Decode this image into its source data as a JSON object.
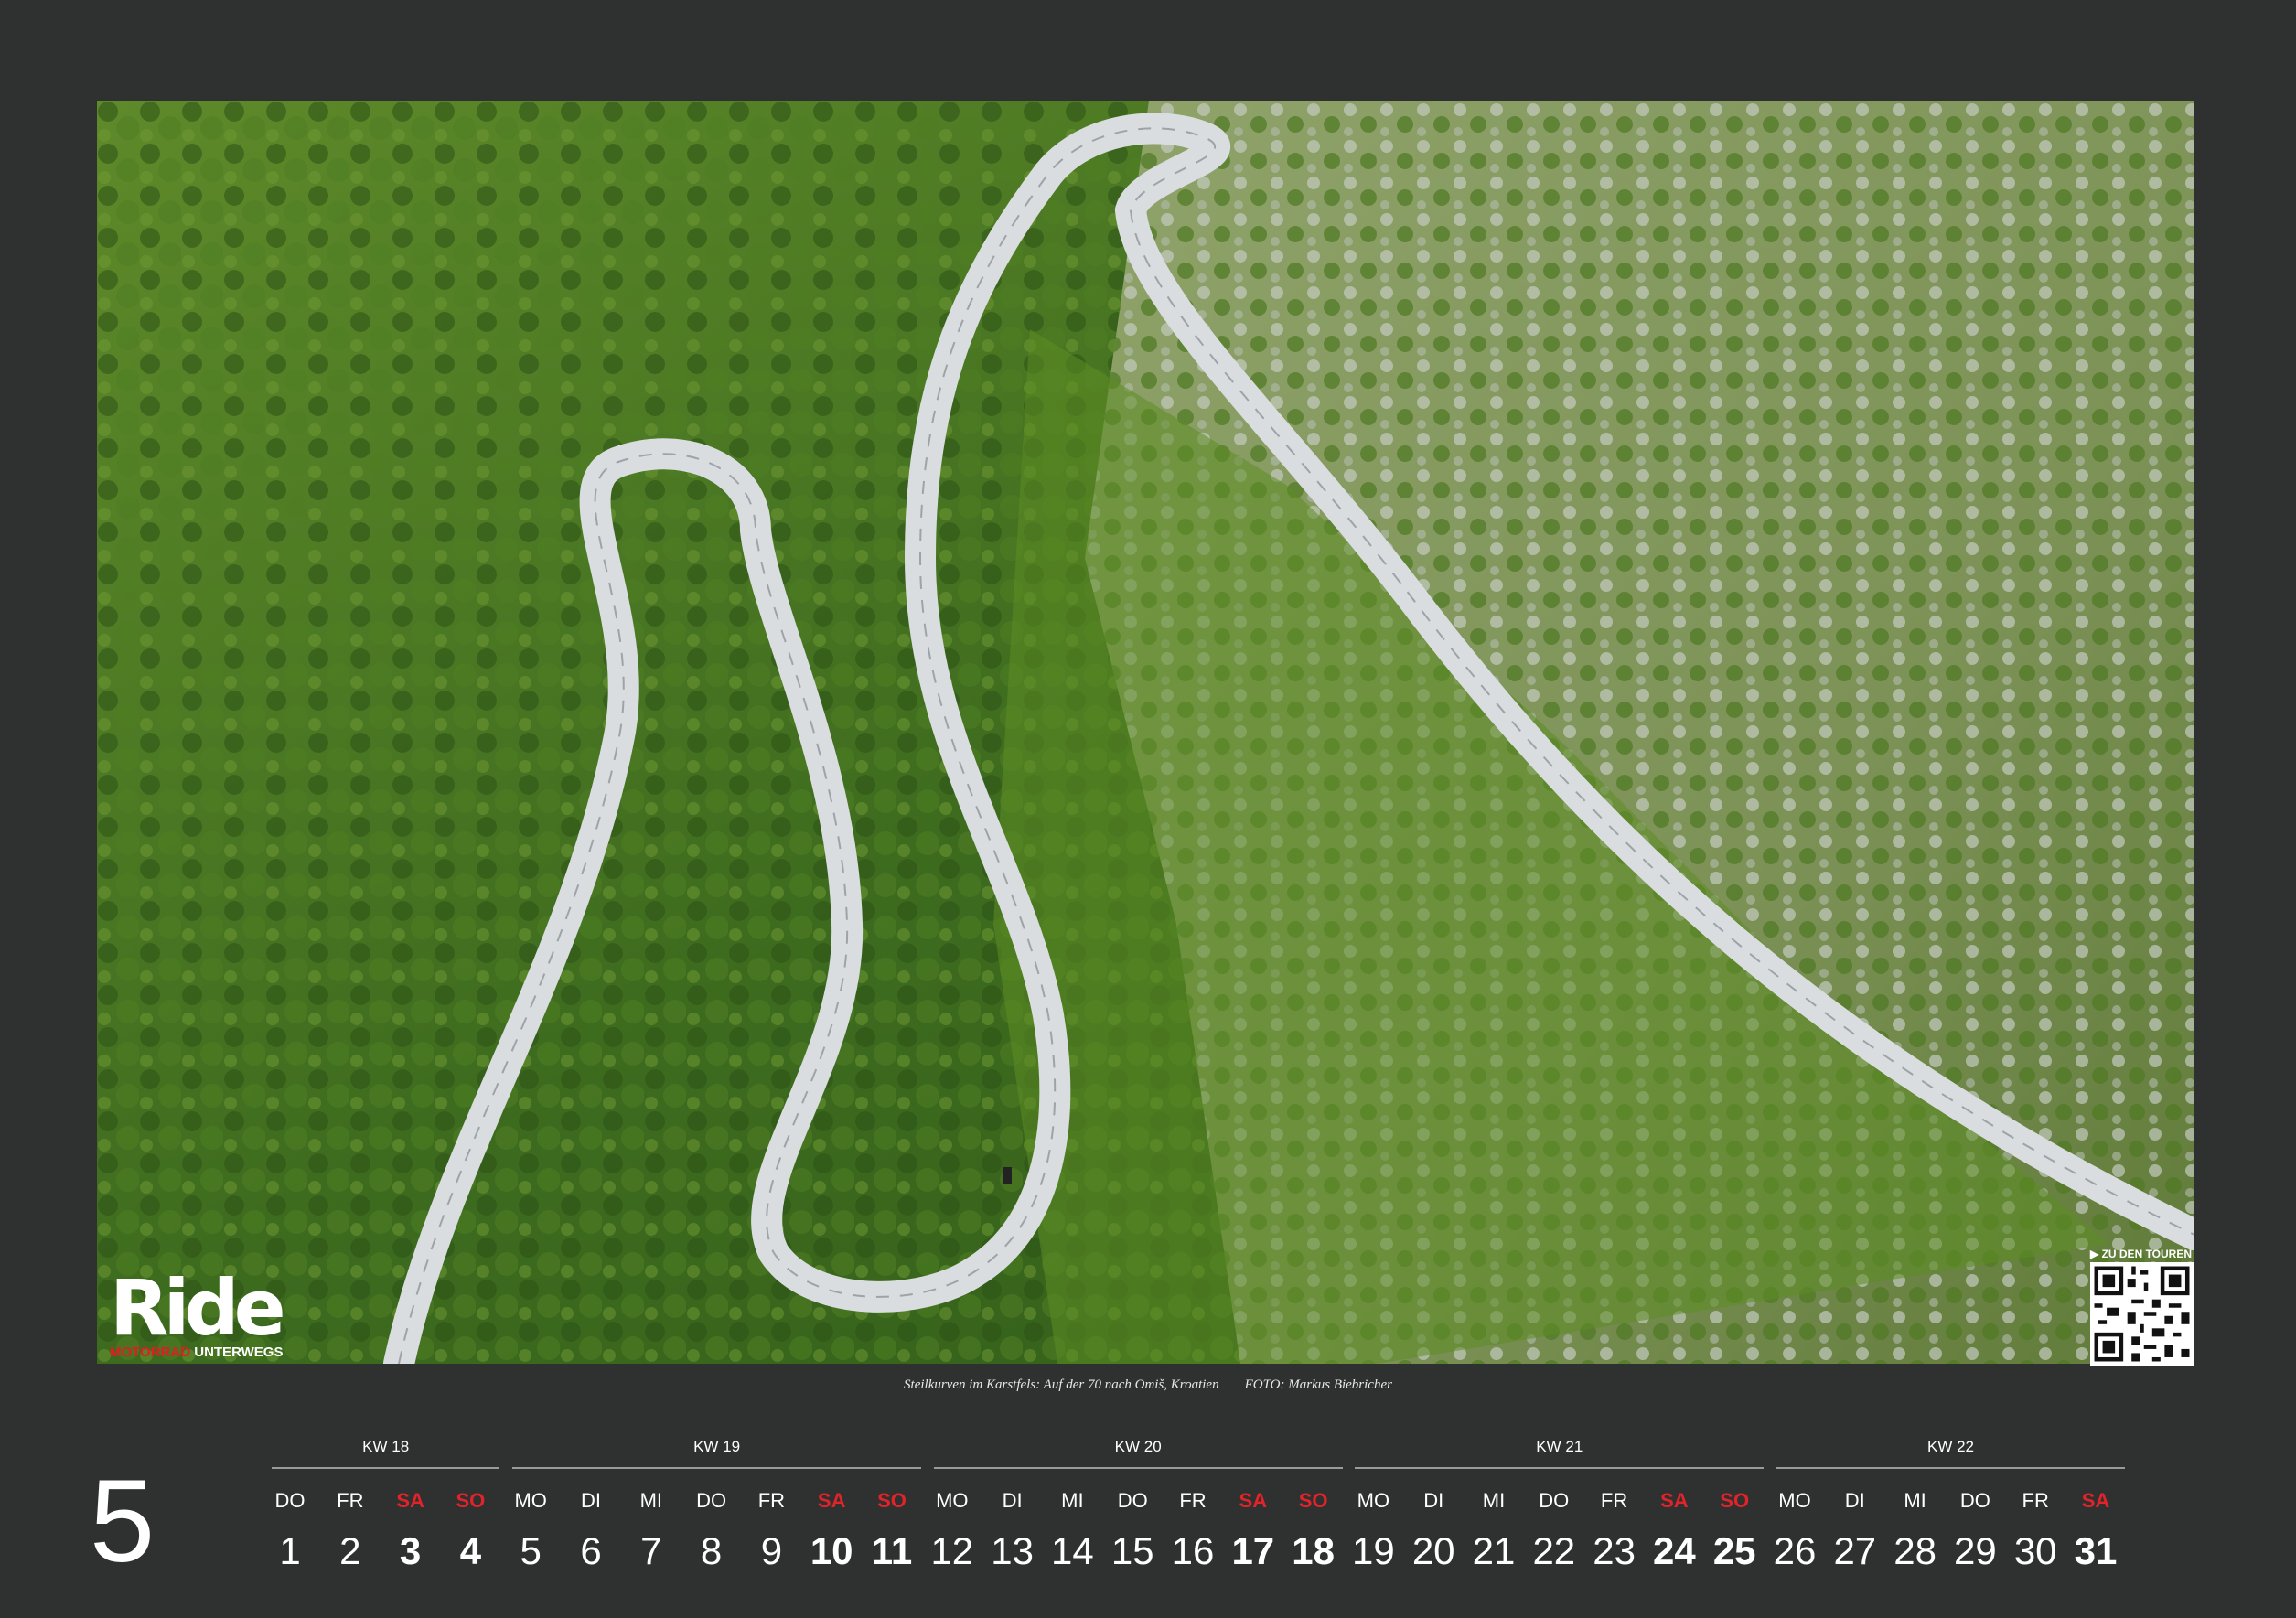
{
  "logo": {
    "main": "Ride",
    "sub_red": "MOTORRAD",
    "sub_white": " UNTERWEGS"
  },
  "qr": {
    "label": "▶ ZU DEN TOUREN"
  },
  "caption": {
    "text": "Steilkurven im Karstfels: Auf der 70 nach Omiš, Kroatien",
    "credit": "FOTO: Markus Biebricher"
  },
  "month_number": "5",
  "colors": {
    "background": "#2f3130",
    "weekend": "#e2232a",
    "text": "#ffffff"
  },
  "weeks": [
    "KW 18",
    "KW 19",
    "KW 20",
    "KW 21",
    "KW 22"
  ],
  "days": [
    {
      "name": "DO",
      "date": "1",
      "weekend": false
    },
    {
      "name": "FR",
      "date": "2",
      "weekend": false
    },
    {
      "name": "SA",
      "date": "3",
      "weekend": true
    },
    {
      "name": "SO",
      "date": "4",
      "weekend": true
    },
    {
      "name": "MO",
      "date": "5",
      "weekend": false
    },
    {
      "name": "DI",
      "date": "6",
      "weekend": false
    },
    {
      "name": "MI",
      "date": "7",
      "weekend": false
    },
    {
      "name": "DO",
      "date": "8",
      "weekend": false
    },
    {
      "name": "FR",
      "date": "9",
      "weekend": false
    },
    {
      "name": "SA",
      "date": "10",
      "weekend": true
    },
    {
      "name": "SO",
      "date": "11",
      "weekend": true
    },
    {
      "name": "MO",
      "date": "12",
      "weekend": false
    },
    {
      "name": "DI",
      "date": "13",
      "weekend": false
    },
    {
      "name": "MI",
      "date": "14",
      "weekend": false
    },
    {
      "name": "DO",
      "date": "15",
      "weekend": false
    },
    {
      "name": "FR",
      "date": "16",
      "weekend": false
    },
    {
      "name": "SA",
      "date": "17",
      "weekend": true
    },
    {
      "name": "SO",
      "date": "18",
      "weekend": true
    },
    {
      "name": "MO",
      "date": "19",
      "weekend": false
    },
    {
      "name": "DI",
      "date": "20",
      "weekend": false
    },
    {
      "name": "MI",
      "date": "21",
      "weekend": false
    },
    {
      "name": "DO",
      "date": "22",
      "weekend": false
    },
    {
      "name": "FR",
      "date": "23",
      "weekend": false
    },
    {
      "name": "SA",
      "date": "24",
      "weekend": true
    },
    {
      "name": "SO",
      "date": "25",
      "weekend": true
    },
    {
      "name": "MO",
      "date": "26",
      "weekend": false
    },
    {
      "name": "DI",
      "date": "27",
      "weekend": false
    },
    {
      "name": "MI",
      "date": "28",
      "weekend": false
    },
    {
      "name": "DO",
      "date": "29",
      "weekend": false
    },
    {
      "name": "FR",
      "date": "30",
      "weekend": false
    },
    {
      "name": "SA",
      "date": "31",
      "weekend": true
    }
  ]
}
